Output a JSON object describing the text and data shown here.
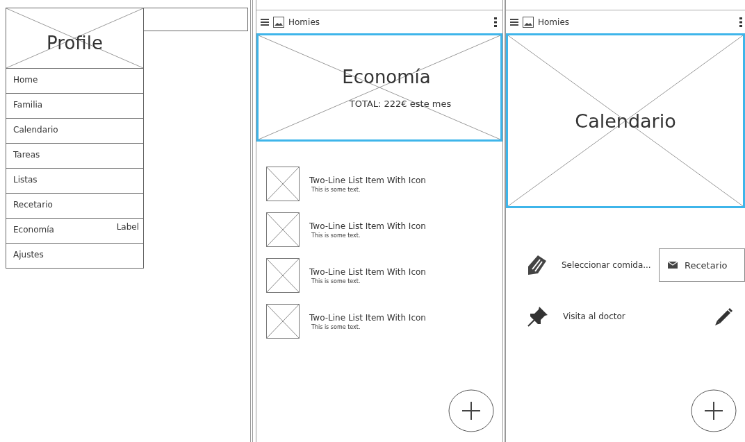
{
  "drawer": {
    "header_title": "Profile",
    "items": [
      {
        "label": "Home"
      },
      {
        "label": "Familia"
      },
      {
        "label": "Calendario"
      },
      {
        "label": "Tareas"
      },
      {
        "label": "Listas"
      },
      {
        "label": "Recetario"
      },
      {
        "label": "Economía",
        "badge": "Label"
      },
      {
        "label": "Ajustes"
      }
    ]
  },
  "economy_screen": {
    "app_bar": {
      "title": "Homies"
    },
    "hero": {
      "title": "Economía",
      "subtitle": "TOTAL: 222€ este mes"
    },
    "list": [
      {
        "title": "Two-Line List Item With Icon",
        "subtitle": "This is some text."
      },
      {
        "title": "Two-Line List Item With Icon",
        "subtitle": "This is some text."
      },
      {
        "title": "Two-Line List Item With Icon",
        "subtitle": "This is some text."
      },
      {
        "title": "Two-Line List Item With Icon",
        "subtitle": "This is some text."
      }
    ]
  },
  "calendar_screen": {
    "app_bar": {
      "title": "Homies"
    },
    "hero": {
      "title": "Calendario"
    },
    "rows": [
      {
        "kind": "meal",
        "label": "Seleccionar comida...",
        "button": "Recetario"
      },
      {
        "kind": "event",
        "label": "Visita al doctor"
      }
    ]
  }
}
